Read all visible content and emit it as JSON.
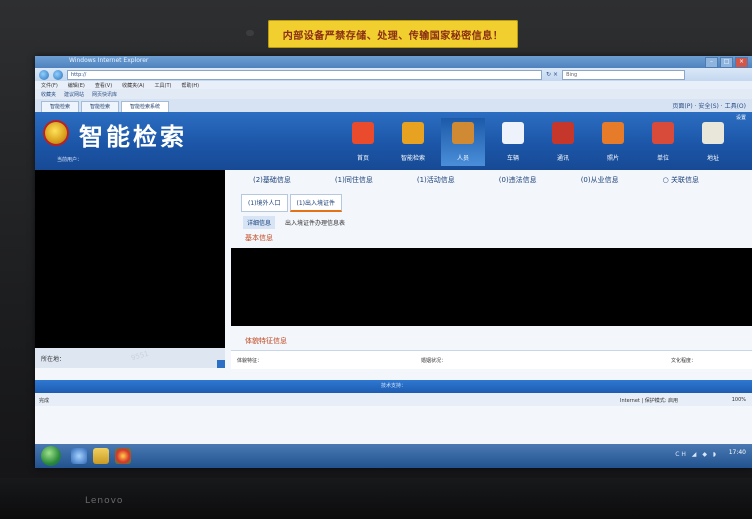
{
  "sticker": {
    "text": "内部设备严禁存储、处理、传输国家秘密信息！"
  },
  "laptop": {
    "brand": "Lenovo"
  },
  "browser": {
    "title_bar": "Windows Internet Explorer",
    "window_buttons": [
      "–",
      "□",
      "×"
    ],
    "url": "http://",
    "address_icons": [
      "↻",
      "×"
    ],
    "search_placeholder": "Bing",
    "menu": [
      "文件(F)",
      "编辑(E)",
      "查看(V)",
      "收藏夹(A)",
      "工具(T)",
      "帮助(H)"
    ],
    "favorites": [
      "收藏夹",
      "建议网站",
      "网页快讯库"
    ],
    "tabs": [
      {
        "label": "智能检索"
      },
      {
        "label": "智能检索"
      },
      {
        "label": "智能检索系统"
      }
    ],
    "toolbar_right": "页面(P) · 安全(S) · 工具(O)",
    "status_left": "完成",
    "status_zone": "Internet | 保护模式: 启用",
    "zoom": "100%"
  },
  "app": {
    "title": "智能检索",
    "user_info": "当前用户：",
    "settings_label": "设置",
    "nav": [
      {
        "label": "首页",
        "icon": "house-icon",
        "color": "#e94b2c"
      },
      {
        "label": "智能检索",
        "icon": "document-search-icon",
        "color": "#e8a221"
      },
      {
        "label": "人员",
        "icon": "person-icon",
        "color": "#d08a34"
      },
      {
        "label": "车辆",
        "icon": "car-icon",
        "color": "#eef3fb"
      },
      {
        "label": "通讯",
        "icon": "book-icon",
        "color": "#c5372a"
      },
      {
        "label": "照片",
        "icon": "photo-icon",
        "color": "#e67b2a"
      },
      {
        "label": "单位",
        "icon": "building-icon",
        "color": "#d84a3a"
      },
      {
        "label": "地址",
        "icon": "map-icon",
        "color": "#e9e6da"
      }
    ],
    "active_nav": 2
  },
  "subnav": [
    "(2)基础信息",
    "(1)同住信息",
    "(1)活动信息",
    "(0)违法信息",
    "(0)从业信息",
    "○ 关联信息"
  ],
  "tabs": [
    {
      "label": "(1)境外人口",
      "active": false
    },
    {
      "label": "(1)出入境证件",
      "active": true
    }
  ],
  "subtabs": [
    {
      "label": "详细信息",
      "active": true
    },
    {
      "label": "出入境证件办理信息表",
      "active": false
    }
  ],
  "section_basic": "基本信息",
  "left_strip_label": "所在地：",
  "watermark": "9551",
  "feature_section": "体貌特征信息",
  "feature_fields": [
    "体貌特征：",
    "婚姻状况：",
    "文化程度："
  ],
  "footer_text": "技术支持：",
  "taskbar": {
    "clock": "17:40",
    "tray": "CH ◢ ◆ ◗"
  }
}
